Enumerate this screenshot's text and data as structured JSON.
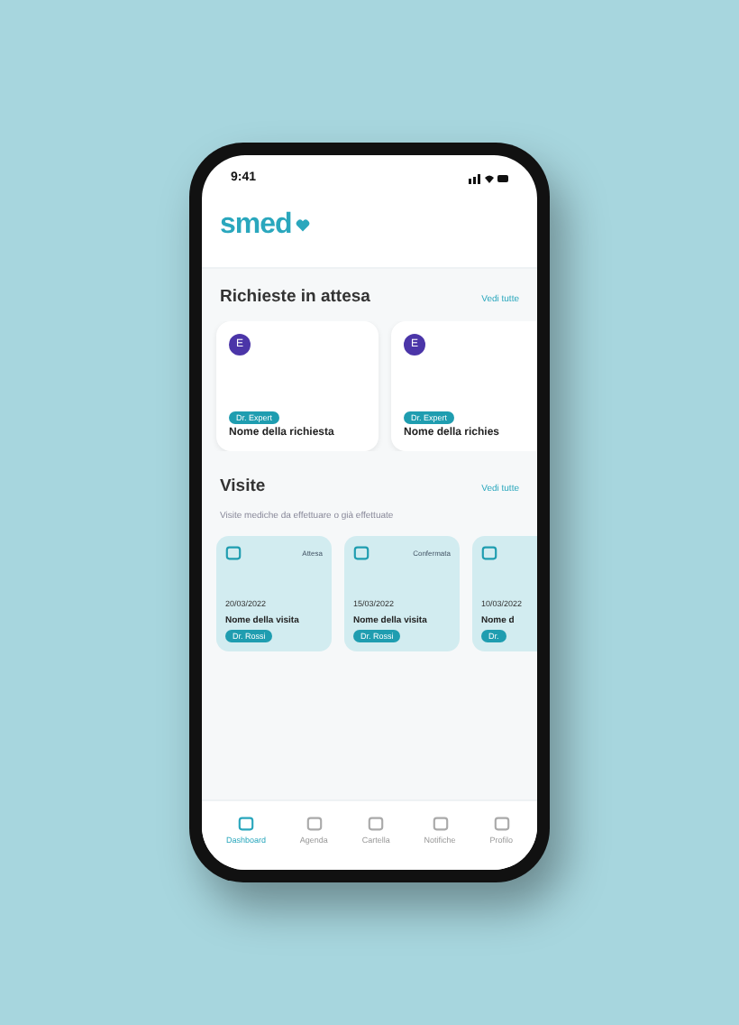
{
  "status_bar": {
    "time": "9:41"
  },
  "logo": {
    "text": "smed"
  },
  "requests": {
    "title": "Richieste in attesa",
    "link": "Vedi tutte",
    "cards": [
      {
        "initial": "E",
        "tag": "Dr. Expert",
        "name": "Nome della richiesta"
      },
      {
        "initial": "E",
        "tag": "Dr. Expert",
        "name": "Nome della richies"
      }
    ]
  },
  "visits": {
    "title": "Visite",
    "link": "Vedi tutte",
    "subtitle": "Visite mediche da effettuare o già effettuate",
    "cards": [
      {
        "status": "Attesa",
        "date": "20/03/2022",
        "name": "Nome della visita",
        "tag": "Dr. Rossi"
      },
      {
        "status": "Confermata",
        "date": "15/03/2022",
        "name": "Nome della visita",
        "tag": "Dr. Rossi"
      },
      {
        "date": "10/03/2022",
        "name": "Nome d",
        "tag": "Dr."
      }
    ]
  },
  "tab_bar": [
    {
      "label": "Dashboard",
      "selected": true
    },
    {
      "label": "Agenda",
      "selected": false
    },
    {
      "label": "Cartella",
      "selected": false
    },
    {
      "label": "Notifiche",
      "selected": false
    },
    {
      "label": "Profilo",
      "selected": false
    }
  ]
}
